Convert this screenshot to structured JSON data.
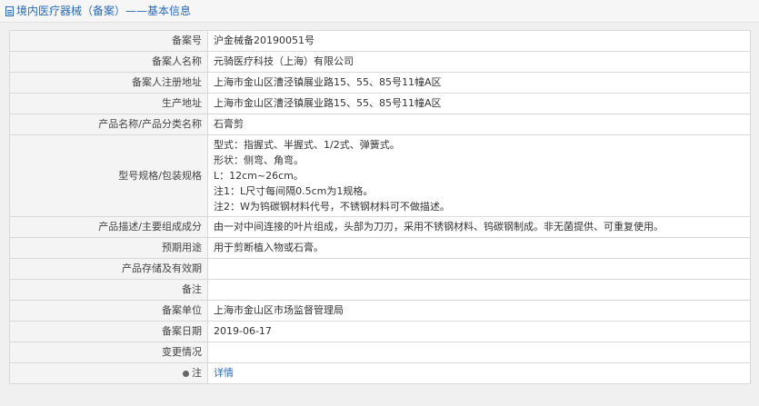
{
  "header": {
    "title": "境内医疗器械（备案）——基本信息"
  },
  "rows": {
    "filing_no": {
      "label": "备案号",
      "value": "沪金械备20190051号"
    },
    "filer_name": {
      "label": "备案人名称",
      "value": "元骑医疗科技（上海）有限公司"
    },
    "filer_address": {
      "label": "备案人注册地址",
      "value": "上海市金山区漕泾镇展业路15、55、85号11幢A区"
    },
    "production_address": {
      "label": "生产地址",
      "value": "上海市金山区漕泾镇展业路15、55、85号11幢A区"
    },
    "product_name": {
      "label": "产品名称/产品分类名称",
      "value": "石膏剪"
    },
    "model_spec": {
      "label": "型号规格/包装规格",
      "lines": [
        "型式：指握式、半握式、1/2式、弹簧式。",
        "形状：侧弯、角弯。",
        "L：12cm~26cm。",
        "注1：L尺寸每间隔0.5cm为1规格。",
        "注2：W为钨碳钢材料代号，不锈钢材料可不做描述。"
      ]
    },
    "description": {
      "label": "产品描述/主要组成成分",
      "value": "由一对中间连接的叶片组成，头部为刀刃，采用不锈钢材料、钨碳钢制成。非无菌提供、可重复使用。"
    },
    "intended_use": {
      "label": "预期用途",
      "value": "用于剪断植入物或石膏。"
    },
    "storage": {
      "label": "产品存储及有效期",
      "value": ""
    },
    "remarks": {
      "label": "备注",
      "value": ""
    },
    "filing_unit": {
      "label": "备案单位",
      "value": "上海市金山区市场监督管理局"
    },
    "filing_date": {
      "label": "备案日期",
      "value": "2019-06-17"
    },
    "changes": {
      "label": "变更情况",
      "value": ""
    },
    "note": {
      "label": "注",
      "link": "详情"
    }
  }
}
